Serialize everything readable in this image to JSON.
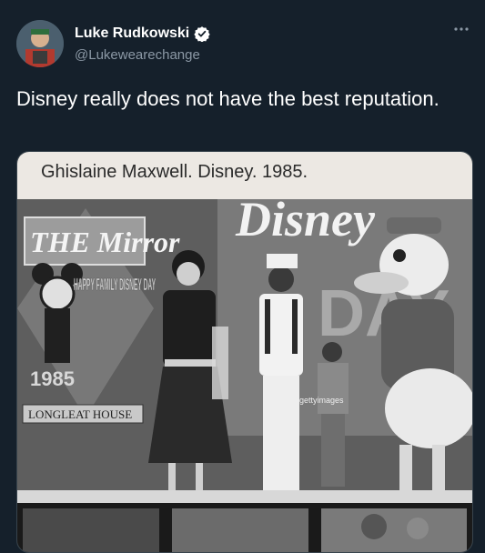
{
  "tweet": {
    "author": {
      "display_name": "Luke Rudkowski",
      "handle": "@Lukewearechange",
      "verified": true
    },
    "more_icon": "more-dots-icon",
    "text": "Disney really does not have the best reputation.",
    "media": {
      "caption": "Ghislaine Maxwell.  Disney.  1985.",
      "photo_texts": {
        "mirror": "THE Mirror",
        "happy_family": "HAPPY FAMILY DISNEY DAY",
        "year": "1985",
        "house": "LONGLEAT HOUSE",
        "disney": "Disney",
        "watermark": "gettyimages"
      }
    }
  },
  "colors": {
    "background": "#15202b",
    "text": "#ffffff",
    "secondary_text": "#8b98a5",
    "verified_badge": "#ffffff",
    "border": "#38444d"
  }
}
